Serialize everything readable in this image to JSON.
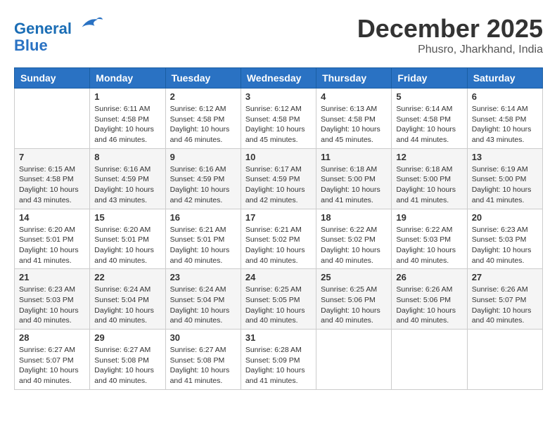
{
  "header": {
    "logo_line1": "General",
    "logo_line2": "Blue",
    "month_title": "December 2025",
    "location": "Phusro, Jharkhand, India"
  },
  "days_of_week": [
    "Sunday",
    "Monday",
    "Tuesday",
    "Wednesday",
    "Thursday",
    "Friday",
    "Saturday"
  ],
  "weeks": [
    [
      {
        "day": "",
        "info": ""
      },
      {
        "day": "1",
        "info": "Sunrise: 6:11 AM\nSunset: 4:58 PM\nDaylight: 10 hours\nand 46 minutes."
      },
      {
        "day": "2",
        "info": "Sunrise: 6:12 AM\nSunset: 4:58 PM\nDaylight: 10 hours\nand 46 minutes."
      },
      {
        "day": "3",
        "info": "Sunrise: 6:12 AM\nSunset: 4:58 PM\nDaylight: 10 hours\nand 45 minutes."
      },
      {
        "day": "4",
        "info": "Sunrise: 6:13 AM\nSunset: 4:58 PM\nDaylight: 10 hours\nand 45 minutes."
      },
      {
        "day": "5",
        "info": "Sunrise: 6:14 AM\nSunset: 4:58 PM\nDaylight: 10 hours\nand 44 minutes."
      },
      {
        "day": "6",
        "info": "Sunrise: 6:14 AM\nSunset: 4:58 PM\nDaylight: 10 hours\nand 43 minutes."
      }
    ],
    [
      {
        "day": "7",
        "info": "Sunrise: 6:15 AM\nSunset: 4:58 PM\nDaylight: 10 hours\nand 43 minutes."
      },
      {
        "day": "8",
        "info": "Sunrise: 6:16 AM\nSunset: 4:59 PM\nDaylight: 10 hours\nand 43 minutes."
      },
      {
        "day": "9",
        "info": "Sunrise: 6:16 AM\nSunset: 4:59 PM\nDaylight: 10 hours\nand 42 minutes."
      },
      {
        "day": "10",
        "info": "Sunrise: 6:17 AM\nSunset: 4:59 PM\nDaylight: 10 hours\nand 42 minutes."
      },
      {
        "day": "11",
        "info": "Sunrise: 6:18 AM\nSunset: 5:00 PM\nDaylight: 10 hours\nand 41 minutes."
      },
      {
        "day": "12",
        "info": "Sunrise: 6:18 AM\nSunset: 5:00 PM\nDaylight: 10 hours\nand 41 minutes."
      },
      {
        "day": "13",
        "info": "Sunrise: 6:19 AM\nSunset: 5:00 PM\nDaylight: 10 hours\nand 41 minutes."
      }
    ],
    [
      {
        "day": "14",
        "info": "Sunrise: 6:20 AM\nSunset: 5:01 PM\nDaylight: 10 hours\nand 41 minutes."
      },
      {
        "day": "15",
        "info": "Sunrise: 6:20 AM\nSunset: 5:01 PM\nDaylight: 10 hours\nand 40 minutes."
      },
      {
        "day": "16",
        "info": "Sunrise: 6:21 AM\nSunset: 5:01 PM\nDaylight: 10 hours\nand 40 minutes."
      },
      {
        "day": "17",
        "info": "Sunrise: 6:21 AM\nSunset: 5:02 PM\nDaylight: 10 hours\nand 40 minutes."
      },
      {
        "day": "18",
        "info": "Sunrise: 6:22 AM\nSunset: 5:02 PM\nDaylight: 10 hours\nand 40 minutes."
      },
      {
        "day": "19",
        "info": "Sunrise: 6:22 AM\nSunset: 5:03 PM\nDaylight: 10 hours\nand 40 minutes."
      },
      {
        "day": "20",
        "info": "Sunrise: 6:23 AM\nSunset: 5:03 PM\nDaylight: 10 hours\nand 40 minutes."
      }
    ],
    [
      {
        "day": "21",
        "info": "Sunrise: 6:23 AM\nSunset: 5:03 PM\nDaylight: 10 hours\nand 40 minutes."
      },
      {
        "day": "22",
        "info": "Sunrise: 6:24 AM\nSunset: 5:04 PM\nDaylight: 10 hours\nand 40 minutes."
      },
      {
        "day": "23",
        "info": "Sunrise: 6:24 AM\nSunset: 5:04 PM\nDaylight: 10 hours\nand 40 minutes."
      },
      {
        "day": "24",
        "info": "Sunrise: 6:25 AM\nSunset: 5:05 PM\nDaylight: 10 hours\nand 40 minutes."
      },
      {
        "day": "25",
        "info": "Sunrise: 6:25 AM\nSunset: 5:06 PM\nDaylight: 10 hours\nand 40 minutes."
      },
      {
        "day": "26",
        "info": "Sunrise: 6:26 AM\nSunset: 5:06 PM\nDaylight: 10 hours\nand 40 minutes."
      },
      {
        "day": "27",
        "info": "Sunrise: 6:26 AM\nSunset: 5:07 PM\nDaylight: 10 hours\nand 40 minutes."
      }
    ],
    [
      {
        "day": "28",
        "info": "Sunrise: 6:27 AM\nSunset: 5:07 PM\nDaylight: 10 hours\nand 40 minutes."
      },
      {
        "day": "29",
        "info": "Sunrise: 6:27 AM\nSunset: 5:08 PM\nDaylight: 10 hours\nand 40 minutes."
      },
      {
        "day": "30",
        "info": "Sunrise: 6:27 AM\nSunset: 5:08 PM\nDaylight: 10 hours\nand 41 minutes."
      },
      {
        "day": "31",
        "info": "Sunrise: 6:28 AM\nSunset: 5:09 PM\nDaylight: 10 hours\nand 41 minutes."
      },
      {
        "day": "",
        "info": ""
      },
      {
        "day": "",
        "info": ""
      },
      {
        "day": "",
        "info": ""
      }
    ]
  ]
}
